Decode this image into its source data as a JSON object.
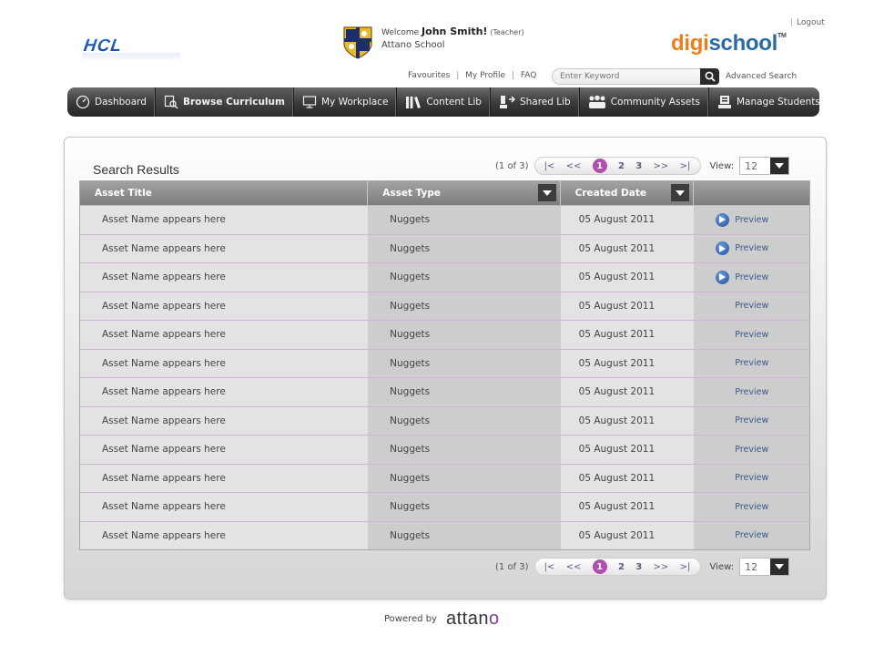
{
  "header": {
    "hcl_logo": "HCL",
    "welcome_prefix": "Welcome",
    "user_name": "John Smith!",
    "user_role": "(Teacher)",
    "school_name": "Attano School",
    "logout": "Logout",
    "brand_digi": "digi",
    "brand_school": "school",
    "brand_tm": "TM",
    "links": {
      "favourites": "Favourites",
      "my_profile": "My Profile",
      "faq": "FAQ"
    },
    "search_placeholder": "Enter Keyword",
    "advanced_search": "Advanced Search"
  },
  "nav": {
    "items": [
      {
        "label": "Dashboard",
        "icon": "dashboard-icon"
      },
      {
        "label": "Browse Curriculum",
        "icon": "browse-icon",
        "active": true
      },
      {
        "label": "My Workplace",
        "icon": "monitor-icon"
      },
      {
        "label": "Content Lib",
        "icon": "library-icon"
      },
      {
        "label": "Shared Lib",
        "icon": "share-icon"
      },
      {
        "label": "Community Assets",
        "icon": "community-icon"
      },
      {
        "label": "Manage Students",
        "icon": "students-icon"
      }
    ]
  },
  "results": {
    "title": "Search Results",
    "pager": {
      "count": "(1 of 3)",
      "first": "|<",
      "prev": "<<",
      "pages": [
        "1",
        "2",
        "3"
      ],
      "current": "1",
      "next": ">>",
      "last": ">|",
      "view_label": "View:",
      "view_value": "12"
    },
    "columns": [
      "Asset Title",
      "Asset Type",
      "Created Date",
      ""
    ],
    "rows": [
      {
        "title": "Asset Name appears here",
        "type": "Nuggets",
        "date": "05 August 2011",
        "action": "Preview",
        "play": true
      },
      {
        "title": "Asset Name appears here",
        "type": "Nuggets",
        "date": "05 August 2011",
        "action": "Preview",
        "play": true
      },
      {
        "title": "Asset Name appears here",
        "type": "Nuggets",
        "date": "05 August 2011",
        "action": "Preview",
        "play": true
      },
      {
        "title": "Asset Name appears here",
        "type": "Nuggets",
        "date": "05 August 2011",
        "action": "Preview",
        "play": false
      },
      {
        "title": "Asset Name appears here",
        "type": "Nuggets",
        "date": "05 August 2011",
        "action": "Preview",
        "play": false
      },
      {
        "title": "Asset Name appears here",
        "type": "Nuggets",
        "date": "05 August 2011",
        "action": "Preview",
        "play": false
      },
      {
        "title": "Asset Name appears here",
        "type": "Nuggets",
        "date": "05 August 2011",
        "action": "Preview",
        "play": false
      },
      {
        "title": "Asset Name appears here",
        "type": "Nuggets",
        "date": "05 August 2011",
        "action": "Preview",
        "play": false
      },
      {
        "title": "Asset Name appears here",
        "type": "Nuggets",
        "date": "05 August 2011",
        "action": "Preview",
        "play": false
      },
      {
        "title": "Asset Name appears here",
        "type": "Nuggets",
        "date": "05 August 2011",
        "action": "Preview",
        "play": false
      },
      {
        "title": "Asset Name appears here",
        "type": "Nuggets",
        "date": "05 August 2011",
        "action": "Preview",
        "play": false
      },
      {
        "title": "Asset Name appears here",
        "type": "Nuggets",
        "date": "05 August 2011",
        "action": "Preview",
        "play": false
      }
    ]
  },
  "footer": {
    "powered_by": "Powered by",
    "brand_main": "attan",
    "brand_o": "o"
  },
  "colors": {
    "accent_purple": "#b04fb0",
    "brand_orange": "#e8801f",
    "brand_blue": "#2b6aa6",
    "link_blue": "#3b5a8c"
  }
}
